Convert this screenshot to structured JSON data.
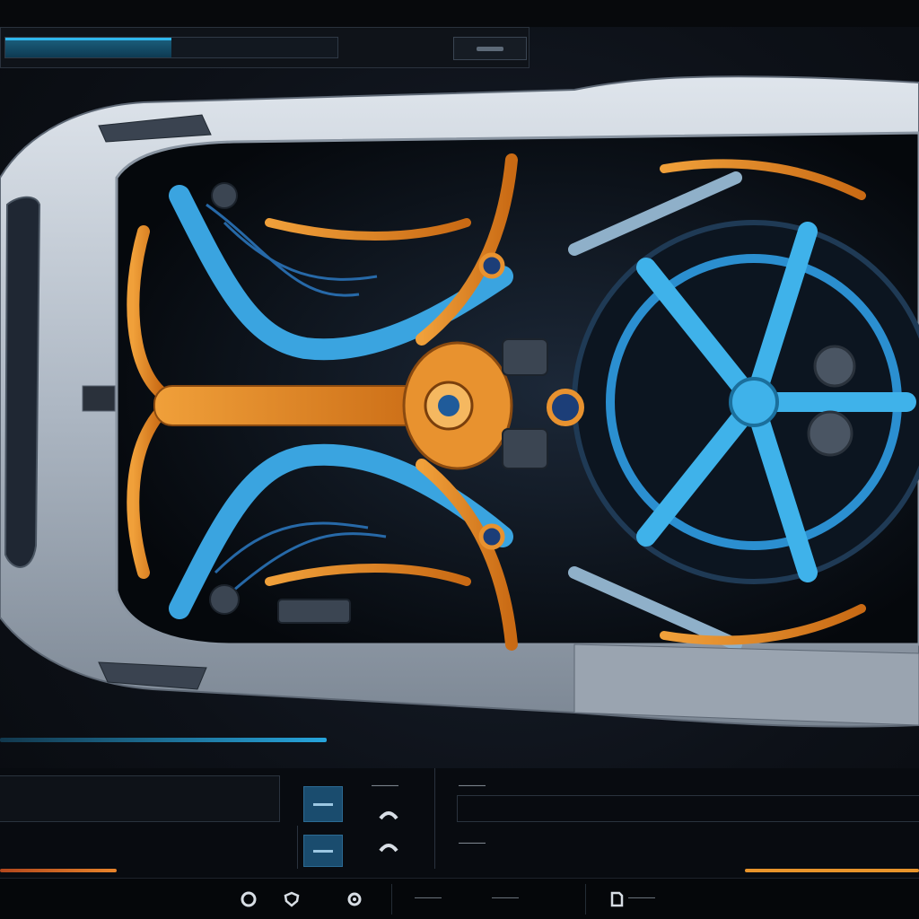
{
  "toolbar": {
    "progress": 0.5
  },
  "controls": {
    "label_top": "———"
  },
  "panel_right": {
    "label_top": "———",
    "label_bottom": "———"
  },
  "status": {
    "text_center": "———",
    "text_right": "———"
  },
  "colors": {
    "accent_blue": "#2fb8ee",
    "accent_orange": "#e8942b",
    "body_silver": "#b9c2cd"
  }
}
